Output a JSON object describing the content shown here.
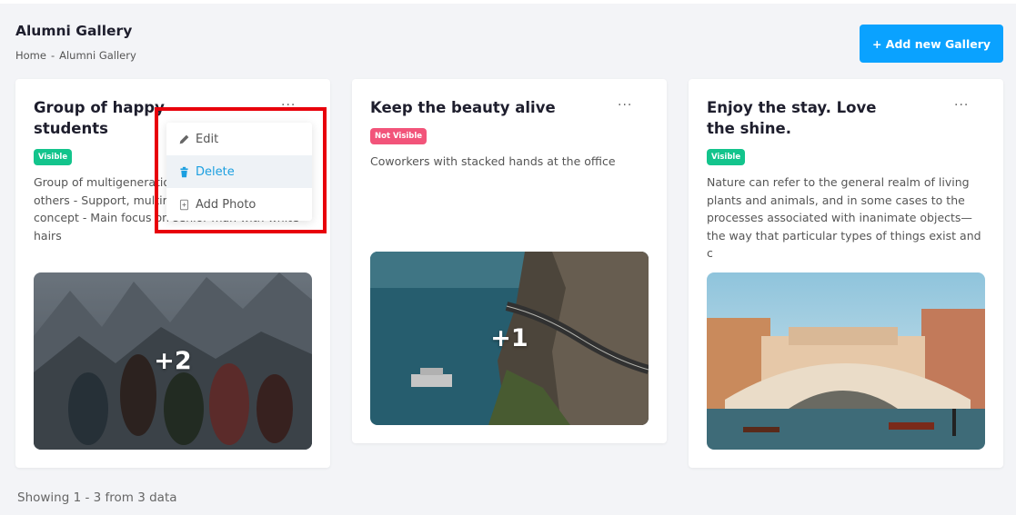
{
  "header": {
    "title": "Alumni Gallery",
    "breadcrumb": [
      "Home",
      "-",
      "Alumni Gallery"
    ],
    "add_button": "+ Add new Gallery"
  },
  "cards": [
    {
      "title": "Group of happy students",
      "menu_icon": "...",
      "badge": "Visible",
      "description": "Group of multigenerational people hugging each others - Support, multiracial and diversity concept - Main focus on senior man with white hairs",
      "photo_count": "+2"
    },
    {
      "title": "Keep the beauty alive",
      "menu_icon": "...",
      "badge": "Not Visible",
      "description": "Coworkers with stacked hands at the office",
      "photo_count": "+1"
    },
    {
      "title": "Enjoy the stay. Love the shine.",
      "menu_icon": "...",
      "badge": "Visible",
      "description": "Nature can refer to the general realm of living plants and animals, and in some cases to the processes associated with inanimate objects—the way that particular types of things exist and c",
      "photo_count": ""
    }
  ],
  "dropdown": {
    "items": [
      {
        "label": "Edit",
        "icon": "pencil-icon"
      },
      {
        "label": "Delete",
        "icon": "trash-icon"
      },
      {
        "label": "Add Photo",
        "icon": "add-photo-icon"
      }
    ]
  },
  "footer": {
    "showing": "Showing 1 - 3 from 3 data"
  },
  "colors": {
    "primary": "#0aa2ff",
    "visible_badge": "#13c48c",
    "not_visible_badge": "#f2547a",
    "highlight": "#e8000b"
  }
}
